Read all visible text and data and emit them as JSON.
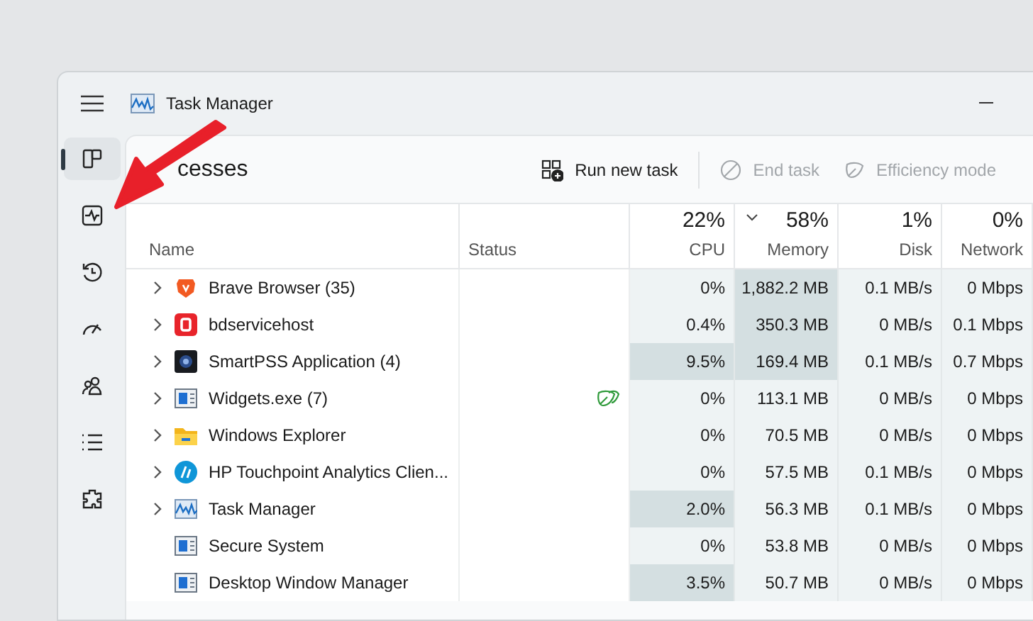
{
  "window": {
    "title": "Task Manager"
  },
  "sidebar": {
    "items": [
      {
        "kind": "processes",
        "selected": true
      },
      {
        "kind": "performance",
        "selected": false
      },
      {
        "kind": "history",
        "selected": false
      },
      {
        "kind": "startup",
        "selected": false
      },
      {
        "kind": "users",
        "selected": false
      },
      {
        "kind": "details",
        "selected": false
      },
      {
        "kind": "services",
        "selected": false
      }
    ]
  },
  "toolbar": {
    "title": "cesses",
    "buttons": [
      {
        "kind": "run",
        "label": "Run new task",
        "disabled": false
      },
      {
        "kind": "end",
        "label": "End task",
        "disabled": true
      },
      {
        "kind": "efficiency",
        "label": "Efficiency mode",
        "disabled": true
      }
    ]
  },
  "table": {
    "columns": [
      {
        "label": "Name",
        "sorted": false
      },
      {
        "label": "Status",
        "sorted": false
      },
      {
        "label": "CPU",
        "total": "22%",
        "sorted": false
      },
      {
        "label": "Memory",
        "total": "58%",
        "sorted": true
      },
      {
        "label": "Disk",
        "total": "1%",
        "sorted": false
      },
      {
        "label": "Network",
        "total": "0%",
        "sorted": false
      }
    ],
    "rows": [
      {
        "name": "Brave Browser (35)",
        "expandable": true,
        "efficiency_mode": false,
        "cpu": "0%",
        "memory": "1,882.2 MB",
        "disk": "0.1 MB/s",
        "network": "0 Mbps",
        "cpu_high": false,
        "memory_high": true
      },
      {
        "name": "bdservicehost",
        "expandable": true,
        "efficiency_mode": false,
        "cpu": "0.4%",
        "memory": "350.3 MB",
        "disk": "0 MB/s",
        "network": "0.1 Mbps",
        "cpu_high": false,
        "memory_high": true
      },
      {
        "name": "SmartPSS Application (4)",
        "expandable": true,
        "efficiency_mode": false,
        "cpu": "9.5%",
        "memory": "169.4 MB",
        "disk": "0.1 MB/s",
        "network": "0.7 Mbps",
        "cpu_high": true,
        "memory_high": true
      },
      {
        "name": "Widgets.exe (7)",
        "expandable": true,
        "efficiency_mode": true,
        "cpu": "0%",
        "memory": "113.1 MB",
        "disk": "0 MB/s",
        "network": "0 Mbps",
        "cpu_high": false,
        "memory_high": false
      },
      {
        "name": "Windows Explorer",
        "expandable": true,
        "efficiency_mode": false,
        "cpu": "0%",
        "memory": "70.5 MB",
        "disk": "0 MB/s",
        "network": "0 Mbps",
        "cpu_high": false,
        "memory_high": false
      },
      {
        "name": "HP Touchpoint Analytics Clien...",
        "expandable": true,
        "efficiency_mode": false,
        "cpu": "0%",
        "memory": "57.5 MB",
        "disk": "0.1 MB/s",
        "network": "0 Mbps",
        "cpu_high": false,
        "memory_high": false
      },
      {
        "name": "Task Manager",
        "expandable": true,
        "efficiency_mode": false,
        "cpu": "2.0%",
        "memory": "56.3 MB",
        "disk": "0.1 MB/s",
        "network": "0 Mbps",
        "cpu_high": true,
        "memory_high": false
      },
      {
        "name": "Secure System",
        "expandable": false,
        "efficiency_mode": false,
        "cpu": "0%",
        "memory": "53.8 MB",
        "disk": "0 MB/s",
        "network": "0 Mbps",
        "cpu_high": false,
        "memory_high": false
      },
      {
        "name": "Desktop Window Manager",
        "expandable": false,
        "efficiency_mode": false,
        "cpu": "3.5%",
        "memory": "50.7 MB",
        "disk": "0 MB/s",
        "network": "0 Mbps",
        "cpu_high": true,
        "memory_high": false
      }
    ]
  }
}
